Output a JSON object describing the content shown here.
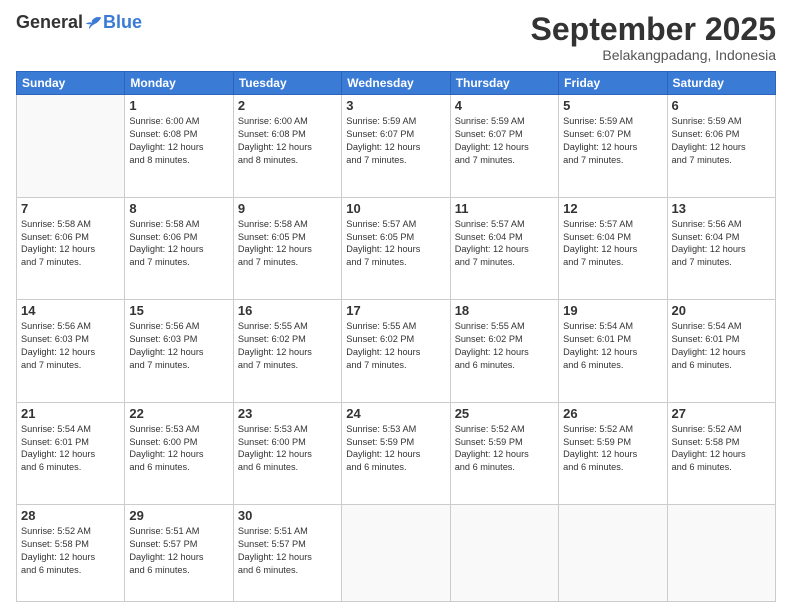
{
  "logo": {
    "general": "General",
    "blue": "Blue"
  },
  "title": "September 2025",
  "location": "Belakangpadang, Indonesia",
  "days_of_week": [
    "Sunday",
    "Monday",
    "Tuesday",
    "Wednesday",
    "Thursday",
    "Friday",
    "Saturday"
  ],
  "weeks": [
    [
      {
        "day": "",
        "info": ""
      },
      {
        "day": "1",
        "info": "Sunrise: 6:00 AM\nSunset: 6:08 PM\nDaylight: 12 hours\nand 8 minutes."
      },
      {
        "day": "2",
        "info": "Sunrise: 6:00 AM\nSunset: 6:08 PM\nDaylight: 12 hours\nand 8 minutes."
      },
      {
        "day": "3",
        "info": "Sunrise: 5:59 AM\nSunset: 6:07 PM\nDaylight: 12 hours\nand 7 minutes."
      },
      {
        "day": "4",
        "info": "Sunrise: 5:59 AM\nSunset: 6:07 PM\nDaylight: 12 hours\nand 7 minutes."
      },
      {
        "day": "5",
        "info": "Sunrise: 5:59 AM\nSunset: 6:07 PM\nDaylight: 12 hours\nand 7 minutes."
      },
      {
        "day": "6",
        "info": "Sunrise: 5:59 AM\nSunset: 6:06 PM\nDaylight: 12 hours\nand 7 minutes."
      }
    ],
    [
      {
        "day": "7",
        "info": "Sunrise: 5:58 AM\nSunset: 6:06 PM\nDaylight: 12 hours\nand 7 minutes."
      },
      {
        "day": "8",
        "info": "Sunrise: 5:58 AM\nSunset: 6:06 PM\nDaylight: 12 hours\nand 7 minutes."
      },
      {
        "day": "9",
        "info": "Sunrise: 5:58 AM\nSunset: 6:05 PM\nDaylight: 12 hours\nand 7 minutes."
      },
      {
        "day": "10",
        "info": "Sunrise: 5:57 AM\nSunset: 6:05 PM\nDaylight: 12 hours\nand 7 minutes."
      },
      {
        "day": "11",
        "info": "Sunrise: 5:57 AM\nSunset: 6:04 PM\nDaylight: 12 hours\nand 7 minutes."
      },
      {
        "day": "12",
        "info": "Sunrise: 5:57 AM\nSunset: 6:04 PM\nDaylight: 12 hours\nand 7 minutes."
      },
      {
        "day": "13",
        "info": "Sunrise: 5:56 AM\nSunset: 6:04 PM\nDaylight: 12 hours\nand 7 minutes."
      }
    ],
    [
      {
        "day": "14",
        "info": "Sunrise: 5:56 AM\nSunset: 6:03 PM\nDaylight: 12 hours\nand 7 minutes."
      },
      {
        "day": "15",
        "info": "Sunrise: 5:56 AM\nSunset: 6:03 PM\nDaylight: 12 hours\nand 7 minutes."
      },
      {
        "day": "16",
        "info": "Sunrise: 5:55 AM\nSunset: 6:02 PM\nDaylight: 12 hours\nand 7 minutes."
      },
      {
        "day": "17",
        "info": "Sunrise: 5:55 AM\nSunset: 6:02 PM\nDaylight: 12 hours\nand 7 minutes."
      },
      {
        "day": "18",
        "info": "Sunrise: 5:55 AM\nSunset: 6:02 PM\nDaylight: 12 hours\nand 6 minutes."
      },
      {
        "day": "19",
        "info": "Sunrise: 5:54 AM\nSunset: 6:01 PM\nDaylight: 12 hours\nand 6 minutes."
      },
      {
        "day": "20",
        "info": "Sunrise: 5:54 AM\nSunset: 6:01 PM\nDaylight: 12 hours\nand 6 minutes."
      }
    ],
    [
      {
        "day": "21",
        "info": "Sunrise: 5:54 AM\nSunset: 6:01 PM\nDaylight: 12 hours\nand 6 minutes."
      },
      {
        "day": "22",
        "info": "Sunrise: 5:53 AM\nSunset: 6:00 PM\nDaylight: 12 hours\nand 6 minutes."
      },
      {
        "day": "23",
        "info": "Sunrise: 5:53 AM\nSunset: 6:00 PM\nDaylight: 12 hours\nand 6 minutes."
      },
      {
        "day": "24",
        "info": "Sunrise: 5:53 AM\nSunset: 5:59 PM\nDaylight: 12 hours\nand 6 minutes."
      },
      {
        "day": "25",
        "info": "Sunrise: 5:52 AM\nSunset: 5:59 PM\nDaylight: 12 hours\nand 6 minutes."
      },
      {
        "day": "26",
        "info": "Sunrise: 5:52 AM\nSunset: 5:59 PM\nDaylight: 12 hours\nand 6 minutes."
      },
      {
        "day": "27",
        "info": "Sunrise: 5:52 AM\nSunset: 5:58 PM\nDaylight: 12 hours\nand 6 minutes."
      }
    ],
    [
      {
        "day": "28",
        "info": "Sunrise: 5:52 AM\nSunset: 5:58 PM\nDaylight: 12 hours\nand 6 minutes."
      },
      {
        "day": "29",
        "info": "Sunrise: 5:51 AM\nSunset: 5:57 PM\nDaylight: 12 hours\nand 6 minutes."
      },
      {
        "day": "30",
        "info": "Sunrise: 5:51 AM\nSunset: 5:57 PM\nDaylight: 12 hours\nand 6 minutes."
      },
      {
        "day": "",
        "info": ""
      },
      {
        "day": "",
        "info": ""
      },
      {
        "day": "",
        "info": ""
      },
      {
        "day": "",
        "info": ""
      }
    ]
  ]
}
